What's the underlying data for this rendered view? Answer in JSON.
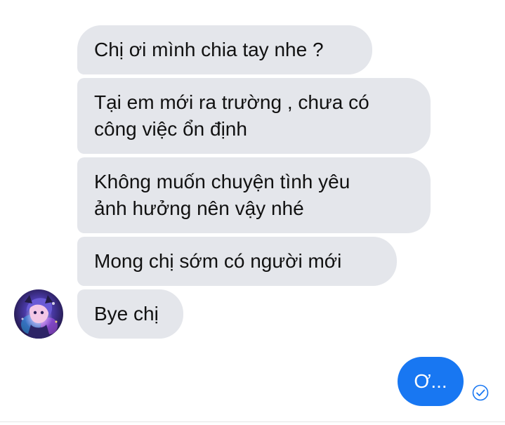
{
  "conversation": {
    "received": [
      {
        "text": "Chị ơi mình chia tay nhe ?"
      },
      {
        "text": "Tại em mới ra trường , chưa có\ncông việc ổn định"
      },
      {
        "text": "Không muốn chuyện tình yêu\nảnh hưởng nên vậy nhé"
      },
      {
        "text": "Mong chị sớm có người mới"
      },
      {
        "text": "Bye chị"
      }
    ],
    "sent": [
      {
        "text": "Ơ..."
      }
    ]
  },
  "icons": {
    "avatar": "contact-avatar",
    "seen": "check-circle-icon"
  },
  "colors": {
    "received_bubble": "#e4e6eb",
    "sent_bubble": "#1877f2",
    "seen_icon": "#1877f2"
  }
}
